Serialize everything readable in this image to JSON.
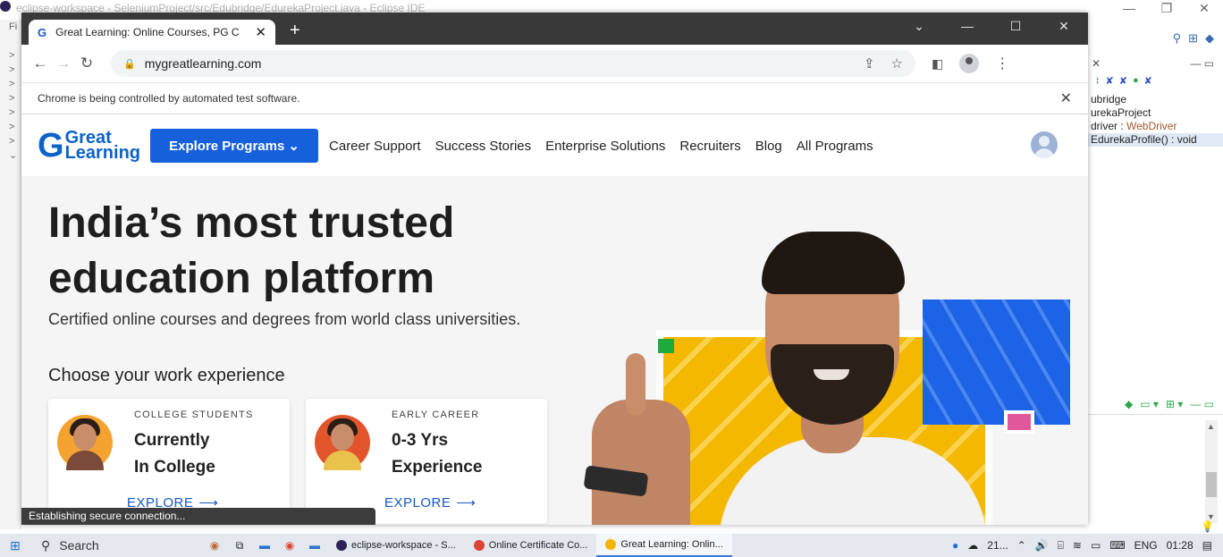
{
  "eclipse": {
    "title": "eclipse-workspace - SeleniumProject/src/Edubridge/EdurekaProject.java - Eclipse IDE",
    "left_gutter": [
      "Fi",
      "",
      ">",
      ">",
      ">",
      ">",
      ">",
      ">",
      ">",
      "⌄"
    ],
    "outline": [
      {
        "text": "ubridge",
        "type": "",
        "selected": false
      },
      {
        "text": "urekaProject",
        "type": "",
        "selected": false
      },
      {
        "text": "driver : ",
        "type": "WebDriver",
        "selected": false
      },
      {
        "text": "EdurekaProfile() : void",
        "type": "",
        "selected": true
      }
    ]
  },
  "chrome": {
    "tab_title": "Great Learning: Online Courses, PG C",
    "new_tab": "+",
    "url": "mygreatlearning.com",
    "infobar_message": "Chrome is being controlled by automated test software.",
    "status_text": "Establishing secure connection..."
  },
  "site": {
    "logo_g": "G",
    "logo_line1": "Great",
    "logo_line2": "Learning",
    "explore_label": "Explore Programs",
    "nav": [
      "Career Support",
      "Success Stories",
      "Enterprise Solutions",
      "Recruiters",
      "Blog",
      "All Programs"
    ],
    "hero_title_1": "India’s most trusted",
    "hero_title_2": "education platform",
    "hero_subtitle": "Certified online courses and degrees from world class universities.",
    "choose_label": "Choose your work experience",
    "cards": [
      {
        "kicker": "COLLEGE STUDENTS",
        "line1": "Currently",
        "line2": "In College",
        "cta": "EXPLORE"
      },
      {
        "kicker": "EARLY CAREER",
        "line1": "0-3 Yrs",
        "line2": "Experience",
        "cta": "EXPLORE"
      }
    ],
    "colors": {
      "brand_blue": "#1660dc",
      "yellow": "#f5b800",
      "green": "#1faa3d",
      "pink": "#e0589c"
    }
  },
  "taskbar": {
    "search_label": "Search",
    "apps": [
      {
        "label": "eclipse-workspace - S...",
        "color": "#2c2255",
        "active": false
      },
      {
        "label": "Online Certificate Co...",
        "color": "#db4437",
        "active": false
      },
      {
        "label": "Great Learning: Onlin...",
        "color": "#f4b400",
        "active": true
      }
    ],
    "weather": "21...",
    "language": "ENG",
    "time": "01:28"
  }
}
